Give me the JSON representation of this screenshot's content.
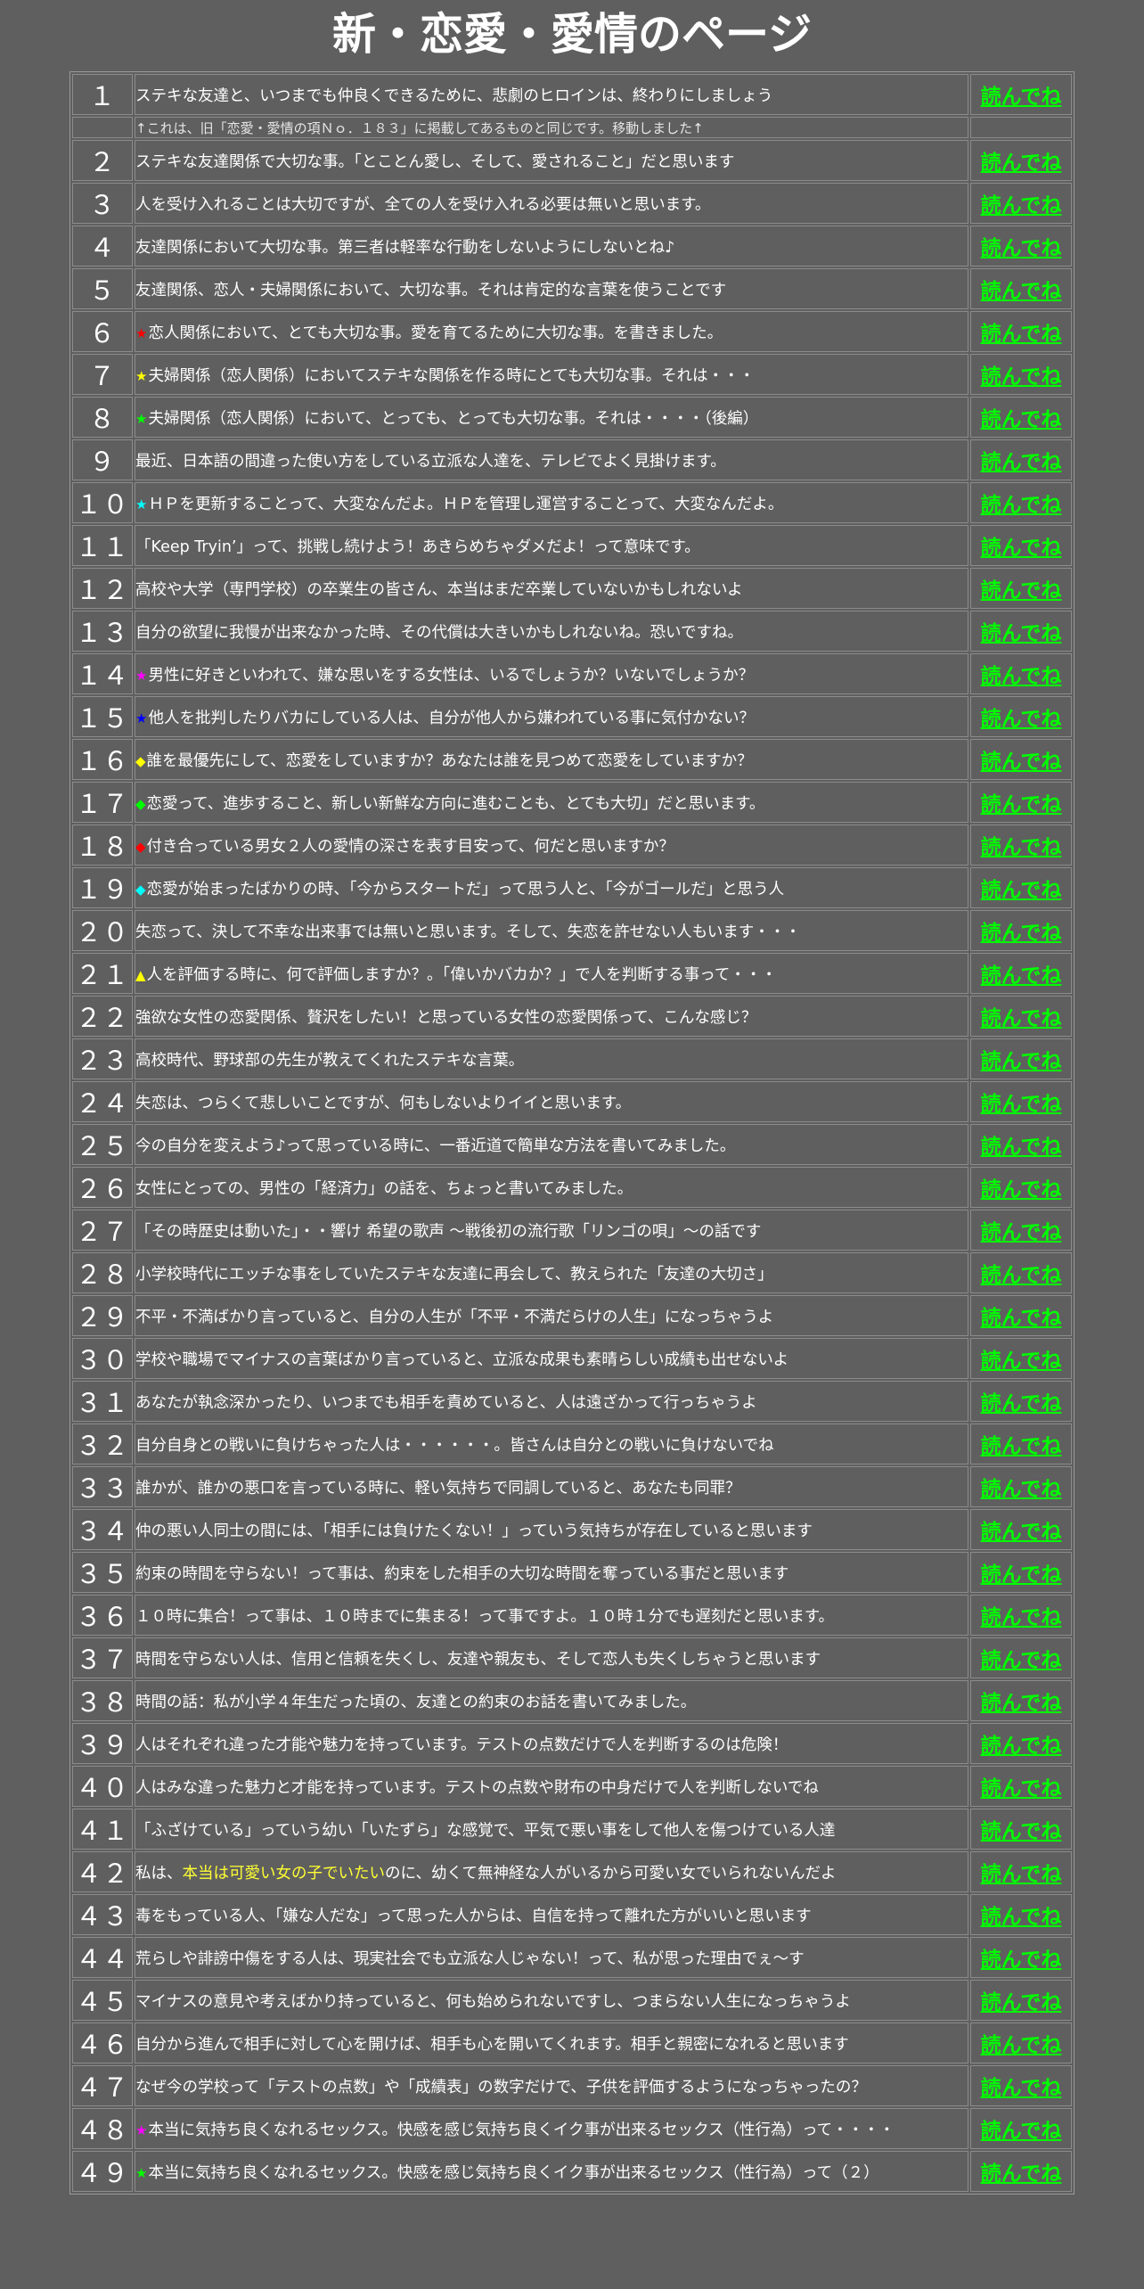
{
  "title": "新・恋愛・愛情のページ",
  "read_label": "読んでね",
  "note": "↑これは、旧「恋愛・愛情の項Ｎｏ．１８３」に掲載してあるものと同じです。移動しました↑",
  "colors": {
    "background": "#5f5f5f",
    "link": "#00ff00",
    "highlight": "#ffff33",
    "red": "#ff0000",
    "yellow": "#ffff00",
    "green": "#00ff00",
    "cyan": "#00ffff",
    "magenta": "#ff00ff",
    "blue": "#0000ff"
  },
  "items": [
    {
      "num": "１",
      "text": "ステキな友達と、いつまでも仲良くできるために、悲劇のヒロインは、終わりにしましょう"
    },
    {
      "num": "２",
      "text": "ステキな友達関係で大切な事。「とことん愛し、そして、愛されること」だと思います"
    },
    {
      "num": "３",
      "text": "人を受け入れることは大切ですが、全ての人を受け入れる必要は無いと思います。"
    },
    {
      "num": "４",
      "text": "友達関係において大切な事。第三者は軽率な行動をしないようにしないとね♪"
    },
    {
      "num": "５",
      "text": "友達関係、恋人・夫婦関係において、大切な事。それは肯定的な言葉を使うことです"
    },
    {
      "num": "６",
      "mark": "★",
      "mark_name": "red-star-icon",
      "mark_color": "#ff0000",
      "text": "恋人関係において、とても大切な事。愛を育てるために大切な事。を書きました。"
    },
    {
      "num": "７",
      "mark": "★",
      "mark_name": "yellow-star-icon",
      "mark_color": "#ffff00",
      "text": "夫婦関係（恋人関係）においてステキな関係を作る時にとても大切な事。それは・・・"
    },
    {
      "num": "８",
      "mark": "★",
      "mark_name": "green-star-icon",
      "mark_color": "#00ff00",
      "text": "夫婦関係（恋人関係）において、とっても、とっても大切な事。それは・・・・（後編）"
    },
    {
      "num": "９",
      "text": "最近、日本語の間違った使い方をしている立派な人達を、テレビでよく見掛けます。"
    },
    {
      "num": "１０",
      "mark": "★",
      "mark_name": "cyan-star-icon",
      "mark_color": "#00ffff",
      "text": "ＨＰを更新することって、大変なんだよ。ＨＰを管理し運営することって、大変なんだよ。"
    },
    {
      "num": "１１",
      "text": "「Keep Tryin’」って、挑戦し続けよう！あきらめちゃダメだよ！って意味です。"
    },
    {
      "num": "１２",
      "text": "高校や大学（専門学校）の卒業生の皆さん、本当はまだ卒業していないかもしれないよ"
    },
    {
      "num": "１３",
      "text": "自分の欲望に我慢が出来なかった時、その代償は大きいかもしれないね。恐いですね。"
    },
    {
      "num": "１４",
      "mark": "★",
      "mark_name": "magenta-star-icon",
      "mark_color": "#ff00ff",
      "text": "男性に好きといわれて、嫌な思いをする女性は、いるでしょうか？いないでしょうか？"
    },
    {
      "num": "１５",
      "mark": "★",
      "mark_name": "blue-star-icon",
      "mark_color": "#0000ff",
      "text": "他人を批判したりバカにしている人は、自分が他人から嫌われている事に気付かない？"
    },
    {
      "num": "１６",
      "mark": "◆",
      "mark_name": "yellow-diamond-icon",
      "mark_color": "#ffff00",
      "text": "誰を最優先にして、恋愛をしていますか？あなたは誰を見つめて恋愛をしていますか？"
    },
    {
      "num": "１７",
      "mark": "◆",
      "mark_name": "green-diamond-icon",
      "mark_color": "#00ff00",
      "text": "恋愛って、進歩すること、新しい新鮮な方向に進むことも、とても大切」だと思います。"
    },
    {
      "num": "１８",
      "mark": "◆",
      "mark_name": "red-diamond-icon",
      "mark_color": "#ff0000",
      "text": "付き合っている男女２人の愛情の深さを表す目安って、何だと思いますか？"
    },
    {
      "num": "１９",
      "mark": "◆",
      "mark_name": "cyan-diamond-icon",
      "mark_color": "#00ffff",
      "text": "恋愛が始まったばかりの時、「今からスタートだ」って思う人と、「今がゴールだ」と思う人"
    },
    {
      "num": "２０",
      "text": "失恋って、決して不幸な出来事では無いと思います。そして、失恋を許せない人もいます・・・"
    },
    {
      "num": "２１",
      "mark": "▲",
      "mark_name": "yellow-triangle-icon",
      "mark_color": "#ffff00",
      "text": "人を評価する時に、何で評価しますか？。「偉いかバカか？」で人を判断する事って・・・"
    },
    {
      "num": "２２",
      "text": "強欲な女性の恋愛関係、贅沢をしたい！と思っている女性の恋愛関係って、こんな感じ？"
    },
    {
      "num": "２３",
      "text": "高校時代、野球部の先生が教えてくれたステキな言葉。"
    },
    {
      "num": "２４",
      "text": "失恋は、つらくて悲しいことですが、何もしないよりイイと思います。"
    },
    {
      "num": "２５",
      "text": "今の自分を変えよう♪って思っている時に、一番近道で簡単な方法を書いてみました。"
    },
    {
      "num": "２６",
      "text": "女性にとっての、男性の「経済力」の話を、ちょっと書いてみました。"
    },
    {
      "num": "２７",
      "text": "「その時歴史は動いた」・・響け 希望の歌声 ～戦後初の流行歌「リンゴの唄」～の話です"
    },
    {
      "num": "２８",
      "text": "小学校時代にエッチな事をしていたステキな友達に再会して、教えられた「友達の大切さ」"
    },
    {
      "num": "２９",
      "text": "不平・不満ばかり言っていると、自分の人生が「不平・不満だらけの人生」になっちゃうよ"
    },
    {
      "num": "３０",
      "text": "学校や職場でマイナスの言葉ばかり言っていると、立派な成果も素晴らしい成績も出せないよ"
    },
    {
      "num": "３１",
      "text": "あなたが執念深かったり、いつまでも相手を責めていると、人は遠ざかって行っちゃうよ"
    },
    {
      "num": "３２",
      "text": "自分自身との戦いに負けちゃった人は・・・・・・。皆さんは自分との戦いに負けないでね"
    },
    {
      "num": "３３",
      "text": "誰かが、誰かの悪口を言っている時に、軽い気持ちで同調していると、あなたも同罪？"
    },
    {
      "num": "３４",
      "text": "仲の悪い人同士の間には、「相手には負けたくない！」っていう気持ちが存在していると思います"
    },
    {
      "num": "３５",
      "text": "約束の時間を守らない！って事は、約束をした相手の大切な時間を奪っている事だと思います"
    },
    {
      "num": "３６",
      "text": "１０時に集合！って事は、１０時までに集まる！って事ですよ。１０時１分でも遅刻だと思います。"
    },
    {
      "num": "３７",
      "text": "時間を守らない人は、信用と信頼を失くし、友達や親友も、そして恋人も失くしちゃうと思います"
    },
    {
      "num": "３８",
      "text": "時間の話：私が小学４年生だった頃の、友達との約束のお話を書いてみました。"
    },
    {
      "num": "３９",
      "text": "人はそれぞれ違った才能や魅力を持っています。テストの点数だけで人を判断するのは危険！"
    },
    {
      "num": "４０",
      "text": "人はみな違った魅力と才能を持っています。テストの点数や財布の中身だけで人を判断しないでね"
    },
    {
      "num": "４１",
      "text": "「ふざけている」っていう幼い「いたずら」な感覚で、平気で悪い事をして他人を傷つけている人達"
    },
    {
      "num": "４２",
      "pre": "私は、",
      "hl": "本当は可愛い女の子でいたい",
      "post": "のに、幼くて無神経な人がいるから可愛い女でいられないんだよ"
    },
    {
      "num": "４３",
      "text": "毒をもっている人、「嫌な人だな」って思った人からは、自信を持って離れた方がいいと思います"
    },
    {
      "num": "４４",
      "text": "荒らしや誹謗中傷をする人は、現実社会でも立派な人じゃない！って、私が思った理由でぇ～す"
    },
    {
      "num": "４５",
      "text": "マイナスの意見や考えばかり持っていると、何も始められないですし、つまらない人生になっちゃうよ"
    },
    {
      "num": "４６",
      "text": "自分から進んで相手に対して心を開けば、相手も心を開いてくれます。相手と親密になれると思います"
    },
    {
      "num": "４７",
      "text": "なぜ今の学校って「テストの点数」や「成績表」の数字だけで、子供を評価するようになっちゃったの？"
    },
    {
      "num": "４８",
      "mark": "★",
      "mark_name": "magenta-star-icon",
      "mark_color": "#ff00ff",
      "text": "本当に気持ち良くなれるセックス。快感を感じ気持ち良くイク事が出来るセックス（性行為）って・・・・"
    },
    {
      "num": "４９",
      "mark": "★",
      "mark_name": "green-star-icon",
      "mark_color": "#00ff00",
      "text": "本当に気持ち良くなれるセックス。快感を感じ気持ち良くイク事が出来るセックス（性行為）って（２）"
    }
  ]
}
